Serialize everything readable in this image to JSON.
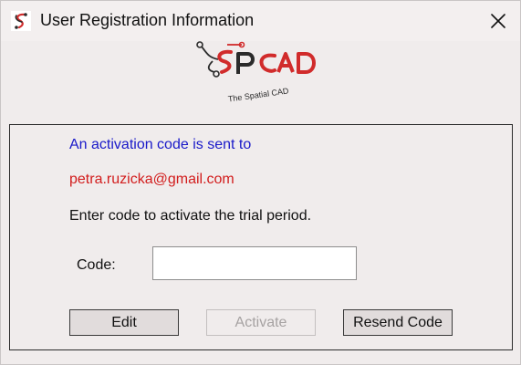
{
  "window": {
    "title": "User Registration Information",
    "app_icon": "spcad-app-icon",
    "close_icon": "close-icon"
  },
  "logo": {
    "wordmark": "SPCAD",
    "tagline": "The Spatial CAD"
  },
  "message": {
    "line1": "An activation code is sent to",
    "email": "petra.ruzicka@gmail.com",
    "line3": "Enter code to activate the trial period."
  },
  "form": {
    "code_label": "Code:",
    "code_value": ""
  },
  "buttons": {
    "edit": "Edit",
    "activate": "Activate",
    "resend": "Resend Code"
  },
  "colors": {
    "info_blue": "#1919c9",
    "email_red": "#d21d1d",
    "logo_red": "#d12b2b",
    "logo_dark": "#2b2b2b"
  }
}
